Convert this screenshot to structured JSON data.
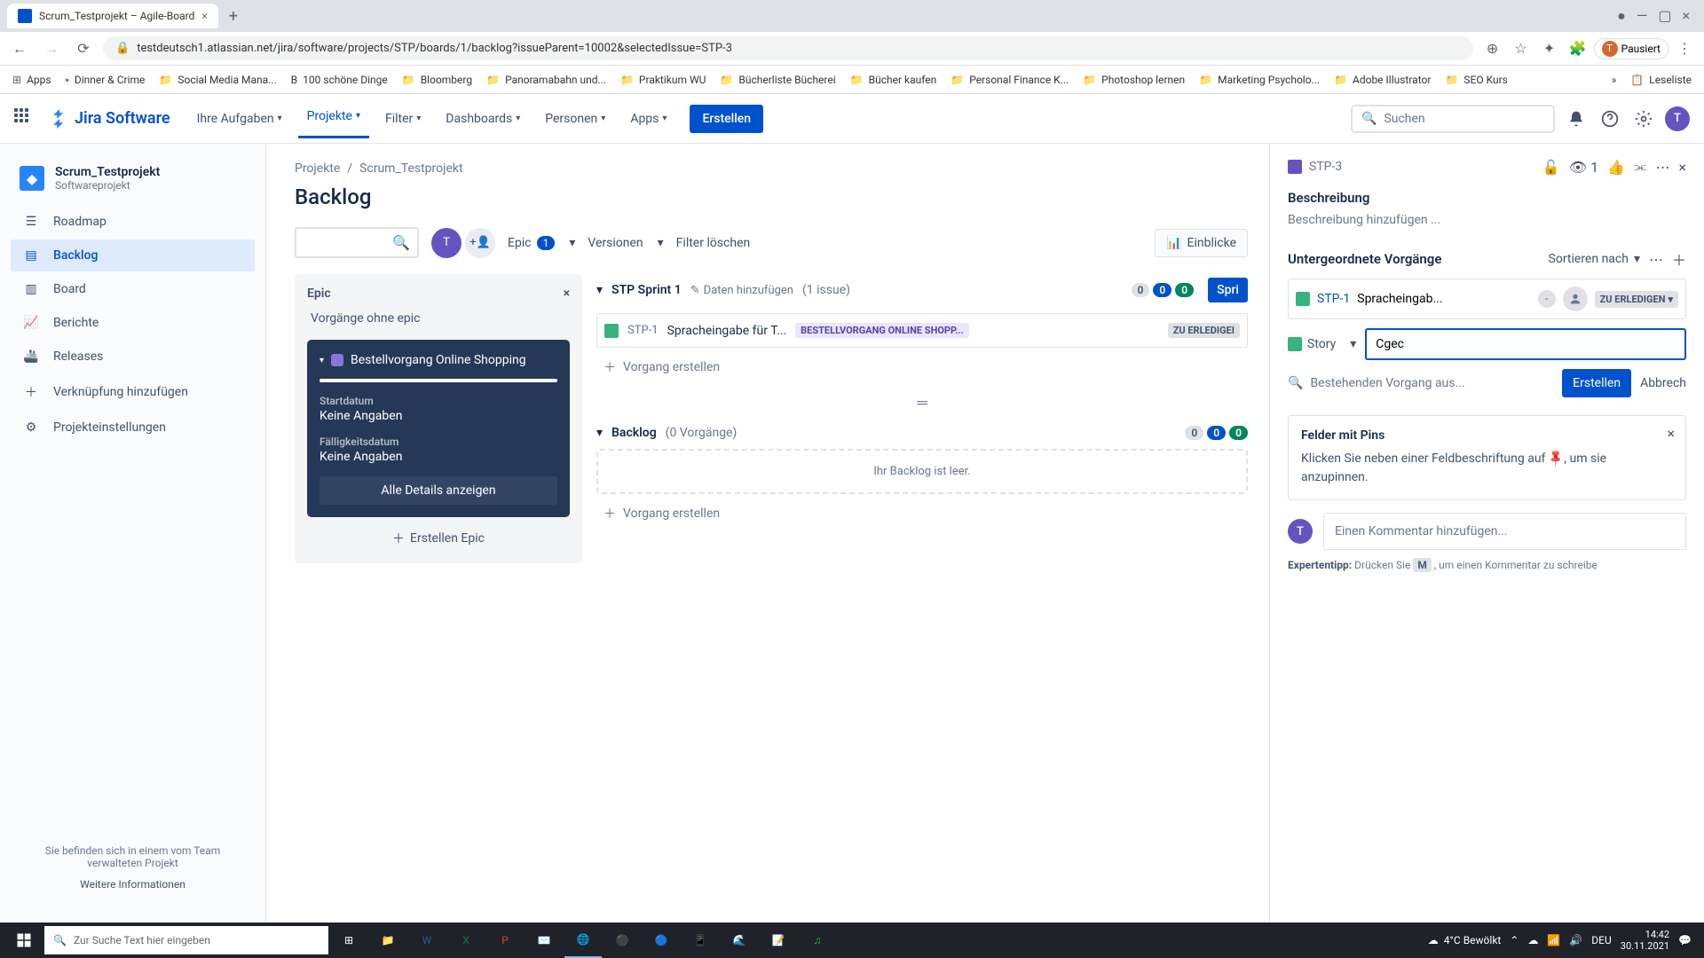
{
  "browser": {
    "tab_title": "Scrum_Testprojekt – Agile-Board",
    "url": "testdeutsch1.atlassian.net/jira/software/projects/STP/boards/1/backlog?issueParent=10002&selectedIssue=STP-3",
    "paused": "Pausiert",
    "bookmarks": [
      "Apps",
      "Dinner & Crime",
      "Social Media Mana...",
      "100 schöne Dinge",
      "Bloomberg",
      "Panoramabahn und...",
      "Praktikum WU",
      "Bücherliste Bücherei",
      "Bücher kaufen",
      "Personal Finance K...",
      "Photoshop lernen",
      "Marketing Psycholo...",
      "Adobe Illustrator",
      "SEO Kurs",
      "Leseliste"
    ]
  },
  "header": {
    "logo": "Jira Software",
    "nav": [
      "Ihre Aufgaben",
      "Projekte",
      "Filter",
      "Dashboards",
      "Personen",
      "Apps"
    ],
    "create": "Erstellen",
    "search_ph": "Suchen"
  },
  "sidebar": {
    "project_name": "Scrum_Testprojekt",
    "project_type": "Softwareprojekt",
    "items": [
      "Roadmap",
      "Backlog",
      "Board",
      "Berichte",
      "Releases",
      "Verknüpfung hinzufügen",
      "Projekteinstellungen"
    ],
    "footer1": "Sie befinden sich in einem vom Team verwalteten Projekt",
    "footer2": "Weitere Informationen"
  },
  "breadcrumb": {
    "a": "Projekte",
    "b": "Scrum_Testprojekt"
  },
  "page_title": "Backlog",
  "toolbar": {
    "epic": "Epic",
    "epic_count": "1",
    "versions": "Versionen",
    "clear": "Filter löschen",
    "insights": "Einblicke"
  },
  "epic_panel": {
    "title": "Epic",
    "no_epic": "Vorgänge ohne epic",
    "card_title": "Bestellvorgang Online Shopping",
    "start_label": "Startdatum",
    "start_value": "Keine Angaben",
    "due_label": "Fälligkeitsdatum",
    "due_value": "Keine Angaben",
    "details": "Alle Details anzeigen",
    "create": "Erstellen Epic"
  },
  "sprint": {
    "name": "STP Sprint 1",
    "add_dates": "Daten hinzufügen",
    "count": "(1 issue)",
    "badges": [
      "0",
      "0",
      "0"
    ],
    "start": "Spri",
    "issue_key": "STP-1",
    "issue_summary": "Spracheingabe für T...",
    "epic_label": "BESTELLVORGANG ONLINE SHOPP...",
    "status": "ZU ERLEDIGEI",
    "create_issue": "Vorgang erstellen"
  },
  "backlog": {
    "name": "Backlog",
    "count": "(0 Vorgänge)",
    "badges": [
      "0",
      "0",
      "0"
    ],
    "empty": "Ihr Backlog ist leer.",
    "create_issue": "Vorgang erstellen"
  },
  "detail": {
    "key": "STP-3",
    "watch_count": "1",
    "desc_title": "Beschreibung",
    "desc_ph": "Beschreibung hinzufügen ...",
    "subtasks_title": "Untergeordnete Vorgänge",
    "sort": "Sortieren nach",
    "sub_key": "STP-1",
    "sub_summary": "Spracheingab...",
    "sub_status": "ZU ERLEDIGEN",
    "story_label": "Story",
    "input_value": "Cgec",
    "existing": "Bestehenden Vorgang aus...",
    "create": "Erstellen",
    "cancel": "Abbrech",
    "pins_title": "Felder mit Pins",
    "pins_text1": "Klicken Sie neben einer Feldbeschriftung auf ",
    "pins_text2": ", um sie anzupinnen.",
    "comment_ph": "Einen Kommentar hinzufügen...",
    "tip_label": "Expertentipp:",
    "tip_text1": "Drücken Sie ",
    "tip_key": "M",
    "tip_text2": " , um einen Kommentar zu schreibe"
  },
  "taskbar": {
    "search_ph": "Zur Suche Text hier eingeben",
    "weather": "4°C  Bewölkt",
    "lang": "DEU",
    "time": "14:42",
    "date": "30.11.2021"
  }
}
